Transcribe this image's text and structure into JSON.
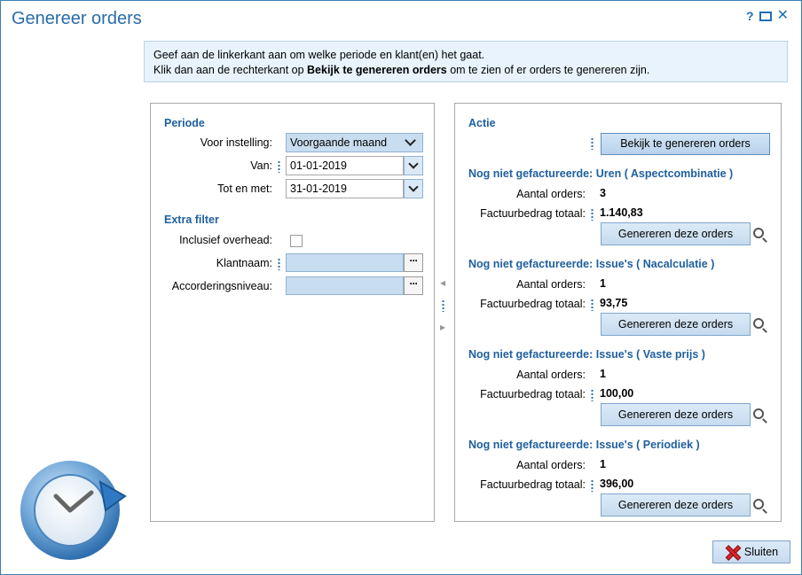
{
  "window": {
    "title": "Genereer orders",
    "controls": {
      "help": "?"
    }
  },
  "info": {
    "line1": "Geef aan de linkerkant aan om welke periode en klant(en) het gaat.",
    "line2_prefix": "Klik dan aan de rechterkant op ",
    "line2_bold": "Bekijk te genereren orders",
    "line2_suffix": " om te zien of er orders te genereren zijn."
  },
  "left": {
    "periode": {
      "title": "Periode",
      "voor_instelling_label": "Voor instelling:",
      "voor_instelling_value": "Voorgaande maand",
      "van_label": "Van:",
      "van_value": "01-01-2019",
      "tot_label": "Tot en met:",
      "tot_value": "31-01-2019"
    },
    "extra_filter": {
      "title": "Extra filter",
      "overhead_label": "Inclusief overhead:",
      "klantnaam_label": "Klantnaam:",
      "accordering_label": "Accorderingsniveau:",
      "dots": "···"
    }
  },
  "right": {
    "title": "Actie",
    "bekijk_button": "Bekijk te genereren orders",
    "aantal_label": "Aantal orders:",
    "bedrag_label": "Factuurbedrag totaal:",
    "generate_button": "Genereren deze orders",
    "groups": [
      {
        "title": "Nog niet gefactureerde: Uren ( Aspectcombinatie )",
        "aantal": "3",
        "bedrag": "1.140,83"
      },
      {
        "title": "Nog niet gefactureerde: Issue's ( Nacalculatie )",
        "aantal": "1",
        "bedrag": "93,75"
      },
      {
        "title": "Nog niet gefactureerde: Issue's ( Vaste prijs )",
        "aantal": "1",
        "bedrag": "100,00"
      },
      {
        "title": "Nog niet gefactureerde: Issue's ( Periodiek )",
        "aantal": "1",
        "bedrag": "396,00"
      }
    ]
  },
  "footer": {
    "close_label": "Sluiten"
  },
  "icons": {
    "logo": "clock-refresh-icon",
    "search": "magnifier-icon",
    "close": "red-x-icon"
  },
  "colors": {
    "accent": "#1f5f9e",
    "title": "#2a6ca8",
    "button": "#c6dbef"
  }
}
